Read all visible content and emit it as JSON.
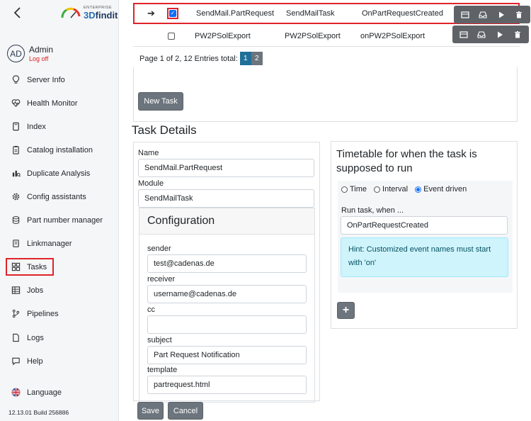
{
  "sidebar": {
    "logo": {
      "small": "ENTERPRISE",
      "big_prefix": "3D",
      "big_suffix": "findit"
    },
    "user": {
      "initials": "AD",
      "name": "Admin",
      "logoff": "Log off"
    },
    "items": [
      {
        "label": "Server Info",
        "icon": "lightbulb-icon"
      },
      {
        "label": "Health Monitor",
        "icon": "heart-pulse-icon"
      },
      {
        "label": "Index",
        "icon": "book-icon"
      },
      {
        "label": "Catalog installation",
        "icon": "clipboard-icon"
      },
      {
        "label": "Duplicate Analysis",
        "icon": "analysis-icon"
      },
      {
        "label": "Config assistants",
        "icon": "gear-icon"
      },
      {
        "label": "Part number manager",
        "icon": "database-icon"
      },
      {
        "label": "Linkmanager",
        "icon": "link-icon"
      },
      {
        "label": "Tasks",
        "icon": "grid-icon"
      },
      {
        "label": "Jobs",
        "icon": "table-icon"
      },
      {
        "label": "Pipelines",
        "icon": "branch-icon"
      },
      {
        "label": "Logs",
        "icon": "document-icon"
      },
      {
        "label": "Help",
        "icon": "chat-icon"
      }
    ],
    "language": {
      "label": "Language",
      "icon": "uk-flag-icon"
    },
    "version": "12.13.01 Build 256886"
  },
  "tasks": {
    "rows": [
      {
        "name": "SendMail.PartRequest",
        "module": "SendMailTask",
        "event": "OnPartRequestCreated",
        "checked": true,
        "selected": true
      },
      {
        "name": "PW2PSolExport",
        "module": "PW2PSolExport",
        "event": "onPW2PSolExport",
        "checked": false,
        "selected": false
      }
    ],
    "pager": {
      "text": "Page 1 of 2, 12 Entries total:",
      "pages": [
        "1",
        "2"
      ],
      "current": "1"
    },
    "new_task_label": "New Task"
  },
  "details": {
    "title": "Task Details",
    "name_label": "Name",
    "name_value": "SendMail.PartRequest",
    "module_label": "Module",
    "module_value": "SendMailTask",
    "config_title": "Configuration",
    "fields": [
      {
        "label": "sender",
        "value": "test@cadenas.de"
      },
      {
        "label": "receiver",
        "value": "username@cadenas.de"
      },
      {
        "label": "cc",
        "value": ""
      },
      {
        "label": "subject",
        "value": "Part Request Notification"
      },
      {
        "label": "template",
        "value": "partrequest.html"
      }
    ],
    "save_label": "Save",
    "cancel_label": "Cancel"
  },
  "timetable": {
    "title": "Timetable for when the task is supposed to run",
    "options": [
      "Time",
      "Interval",
      "Event driven"
    ],
    "selected": "Event driven",
    "run_label": "Run task, when ...",
    "event_value": "OnPartRequestCreated",
    "hint": "Hint: Customized event names must start with 'on'",
    "add_label": "+"
  }
}
